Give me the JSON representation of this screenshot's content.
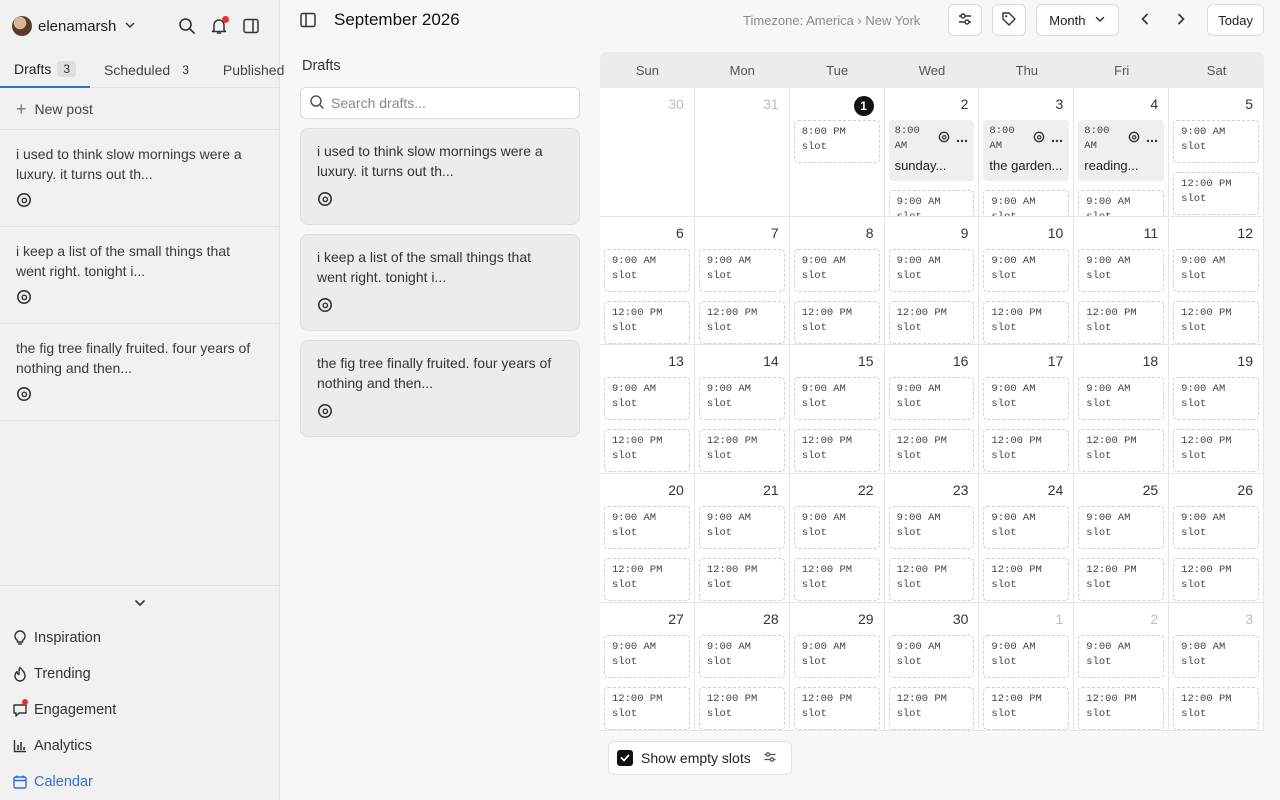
{
  "sidebar": {
    "account": {
      "username": "elenamarsh"
    },
    "tabs": [
      {
        "label": "Drafts",
        "count": "3"
      },
      {
        "label": "Scheduled",
        "count": "3"
      },
      {
        "label": "Published",
        "count": ""
      }
    ],
    "new_post_label": "New post",
    "drafts": [
      {
        "text": "i used to think slow mornings were a luxury. it turns out th..."
      },
      {
        "text": "i keep a list of the small things that went right. tonight i..."
      },
      {
        "text": "the fig tree finally fruited. four years of nothing and then..."
      }
    ],
    "nav": [
      {
        "label": "Inspiration",
        "icon": "lightbulb-icon"
      },
      {
        "label": "Trending",
        "icon": "flame-icon"
      },
      {
        "label": "Engagement",
        "icon": "chat-bubble-icon"
      },
      {
        "label": "Analytics",
        "icon": "bar-chart-icon"
      },
      {
        "label": "Calendar",
        "icon": "calendar-icon"
      }
    ]
  },
  "header": {
    "title": "September 2026",
    "timezone": "Timezone: America › New York",
    "view_label": "Month",
    "today_label": "Today"
  },
  "drafts_panel": {
    "title": "Drafts",
    "search_placeholder": "Search drafts...",
    "items": [
      {
        "text": "i used to think slow mornings were a luxury. it turns out th..."
      },
      {
        "text": "i keep a list of the small things that went right. tonight i..."
      },
      {
        "text": "the fig tree finally fruited. four years of nothing and then..."
      }
    ]
  },
  "calendar": {
    "weekdays": [
      "Sun",
      "Mon",
      "Tue",
      "Wed",
      "Thu",
      "Fri",
      "Sat"
    ],
    "weeks": [
      [
        {
          "day": "30",
          "muted": true,
          "items": []
        },
        {
          "day": "31",
          "muted": true,
          "items": []
        },
        {
          "day": "1",
          "today": true,
          "items": [
            {
              "kind": "slot",
              "time": "8:00 PM",
              "label": "slot"
            }
          ]
        },
        {
          "day": "2",
          "items": [
            {
              "kind": "post",
              "time": "8:00 AM",
              "text": "sunday..."
            },
            {
              "kind": "slot",
              "time": "9:00 AM",
              "label": "slot"
            }
          ]
        },
        {
          "day": "3",
          "items": [
            {
              "kind": "post",
              "time": "8:00 AM",
              "text": "the garden..."
            },
            {
              "kind": "slot",
              "time": "9:00 AM",
              "label": "slot"
            }
          ]
        },
        {
          "day": "4",
          "items": [
            {
              "kind": "post",
              "time": "8:00 AM",
              "text": "reading..."
            },
            {
              "kind": "slot",
              "time": "9:00 AM",
              "label": "slot"
            }
          ]
        },
        {
          "day": "5",
          "items": [
            {
              "kind": "slot",
              "time": "9:00 AM",
              "label": "slot"
            },
            {
              "kind": "slot",
              "time": "12:00 PM",
              "label": "slot"
            }
          ]
        }
      ],
      [
        {
          "day": "6",
          "items": [
            {
              "kind": "slot",
              "time": "9:00 AM",
              "label": "slot"
            },
            {
              "kind": "slot",
              "time": "12:00 PM",
              "label": "slot"
            }
          ]
        },
        {
          "day": "7",
          "items": [
            {
              "kind": "slot",
              "time": "9:00 AM",
              "label": "slot"
            },
            {
              "kind": "slot",
              "time": "12:00 PM",
              "label": "slot"
            }
          ]
        },
        {
          "day": "8",
          "items": [
            {
              "kind": "slot",
              "time": "9:00 AM",
              "label": "slot"
            },
            {
              "kind": "slot",
              "time": "12:00 PM",
              "label": "slot"
            }
          ]
        },
        {
          "day": "9",
          "items": [
            {
              "kind": "slot",
              "time": "9:00 AM",
              "label": "slot"
            },
            {
              "kind": "slot",
              "time": "12:00 PM",
              "label": "slot"
            }
          ]
        },
        {
          "day": "10",
          "items": [
            {
              "kind": "slot",
              "time": "9:00 AM",
              "label": "slot"
            },
            {
              "kind": "slot",
              "time": "12:00 PM",
              "label": "slot"
            }
          ]
        },
        {
          "day": "11",
          "items": [
            {
              "kind": "slot",
              "time": "9:00 AM",
              "label": "slot"
            },
            {
              "kind": "slot",
              "time": "12:00 PM",
              "label": "slot"
            }
          ]
        },
        {
          "day": "12",
          "items": [
            {
              "kind": "slot",
              "time": "9:00 AM",
              "label": "slot"
            },
            {
              "kind": "slot",
              "time": "12:00 PM",
              "label": "slot"
            }
          ]
        }
      ],
      [
        {
          "day": "13",
          "items": [
            {
              "kind": "slot",
              "time": "9:00 AM",
              "label": "slot"
            },
            {
              "kind": "slot",
              "time": "12:00 PM",
              "label": "slot"
            }
          ]
        },
        {
          "day": "14",
          "items": [
            {
              "kind": "slot",
              "time": "9:00 AM",
              "label": "slot"
            },
            {
              "kind": "slot",
              "time": "12:00 PM",
              "label": "slot"
            }
          ]
        },
        {
          "day": "15",
          "items": [
            {
              "kind": "slot",
              "time": "9:00 AM",
              "label": "slot"
            },
            {
              "kind": "slot",
              "time": "12:00 PM",
              "label": "slot"
            }
          ]
        },
        {
          "day": "16",
          "items": [
            {
              "kind": "slot",
              "time": "9:00 AM",
              "label": "slot"
            },
            {
              "kind": "slot",
              "time": "12:00 PM",
              "label": "slot"
            }
          ]
        },
        {
          "day": "17",
          "items": [
            {
              "kind": "slot",
              "time": "9:00 AM",
              "label": "slot"
            },
            {
              "kind": "slot",
              "time": "12:00 PM",
              "label": "slot"
            }
          ]
        },
        {
          "day": "18",
          "items": [
            {
              "kind": "slot",
              "time": "9:00 AM",
              "label": "slot"
            },
            {
              "kind": "slot",
              "time": "12:00 PM",
              "label": "slot"
            }
          ]
        },
        {
          "day": "19",
          "items": [
            {
              "kind": "slot",
              "time": "9:00 AM",
              "label": "slot"
            },
            {
              "kind": "slot",
              "time": "12:00 PM",
              "label": "slot"
            }
          ]
        }
      ],
      [
        {
          "day": "20",
          "items": [
            {
              "kind": "slot",
              "time": "9:00 AM",
              "label": "slot"
            },
            {
              "kind": "slot",
              "time": "12:00 PM",
              "label": "slot"
            }
          ]
        },
        {
          "day": "21",
          "items": [
            {
              "kind": "slot",
              "time": "9:00 AM",
              "label": "slot"
            },
            {
              "kind": "slot",
              "time": "12:00 PM",
              "label": "slot"
            }
          ]
        },
        {
          "day": "22",
          "items": [
            {
              "kind": "slot",
              "time": "9:00 AM",
              "label": "slot"
            },
            {
              "kind": "slot",
              "time": "12:00 PM",
              "label": "slot"
            }
          ]
        },
        {
          "day": "23",
          "items": [
            {
              "kind": "slot",
              "time": "9:00 AM",
              "label": "slot"
            },
            {
              "kind": "slot",
              "time": "12:00 PM",
              "label": "slot"
            }
          ]
        },
        {
          "day": "24",
          "items": [
            {
              "kind": "slot",
              "time": "9:00 AM",
              "label": "slot"
            },
            {
              "kind": "slot",
              "time": "12:00 PM",
              "label": "slot"
            }
          ]
        },
        {
          "day": "25",
          "items": [
            {
              "kind": "slot",
              "time": "9:00 AM",
              "label": "slot"
            },
            {
              "kind": "slot",
              "time": "12:00 PM",
              "label": "slot"
            }
          ]
        },
        {
          "day": "26",
          "items": [
            {
              "kind": "slot",
              "time": "9:00 AM",
              "label": "slot"
            },
            {
              "kind": "slot",
              "time": "12:00 PM",
              "label": "slot"
            }
          ]
        }
      ],
      [
        {
          "day": "27",
          "items": [
            {
              "kind": "slot",
              "time": "9:00 AM",
              "label": "slot"
            },
            {
              "kind": "slot",
              "time": "12:00 PM",
              "label": "slot"
            }
          ]
        },
        {
          "day": "28",
          "items": [
            {
              "kind": "slot",
              "time": "9:00 AM",
              "label": "slot"
            },
            {
              "kind": "slot",
              "time": "12:00 PM",
              "label": "slot"
            }
          ]
        },
        {
          "day": "29",
          "items": [
            {
              "kind": "slot",
              "time": "9:00 AM",
              "label": "slot"
            },
            {
              "kind": "slot",
              "time": "12:00 PM",
              "label": "slot"
            }
          ]
        },
        {
          "day": "30",
          "items": [
            {
              "kind": "slot",
              "time": "9:00 AM",
              "label": "slot"
            },
            {
              "kind": "slot",
              "time": "12:00 PM",
              "label": "slot"
            }
          ]
        },
        {
          "day": "1",
          "muted": true,
          "items": [
            {
              "kind": "slot",
              "time": "9:00 AM",
              "label": "slot"
            },
            {
              "kind": "slot",
              "time": "12:00 PM",
              "label": "slot"
            }
          ]
        },
        {
          "day": "2",
          "muted": true,
          "items": [
            {
              "kind": "slot",
              "time": "9:00 AM",
              "label": "slot"
            },
            {
              "kind": "slot",
              "time": "12:00 PM",
              "label": "slot"
            }
          ]
        },
        {
          "day": "3",
          "muted": true,
          "items": [
            {
              "kind": "slot",
              "time": "9:00 AM",
              "label": "slot"
            },
            {
              "kind": "slot",
              "time": "12:00 PM",
              "label": "slot"
            }
          ]
        }
      ]
    ]
  },
  "footer": {
    "show_empty_slots_label": "Show empty slots",
    "show_empty_slots_checked": true
  },
  "colors": {
    "accent": "#2f6fe0",
    "notification": "#e5322d",
    "today_marker": "#111111"
  }
}
